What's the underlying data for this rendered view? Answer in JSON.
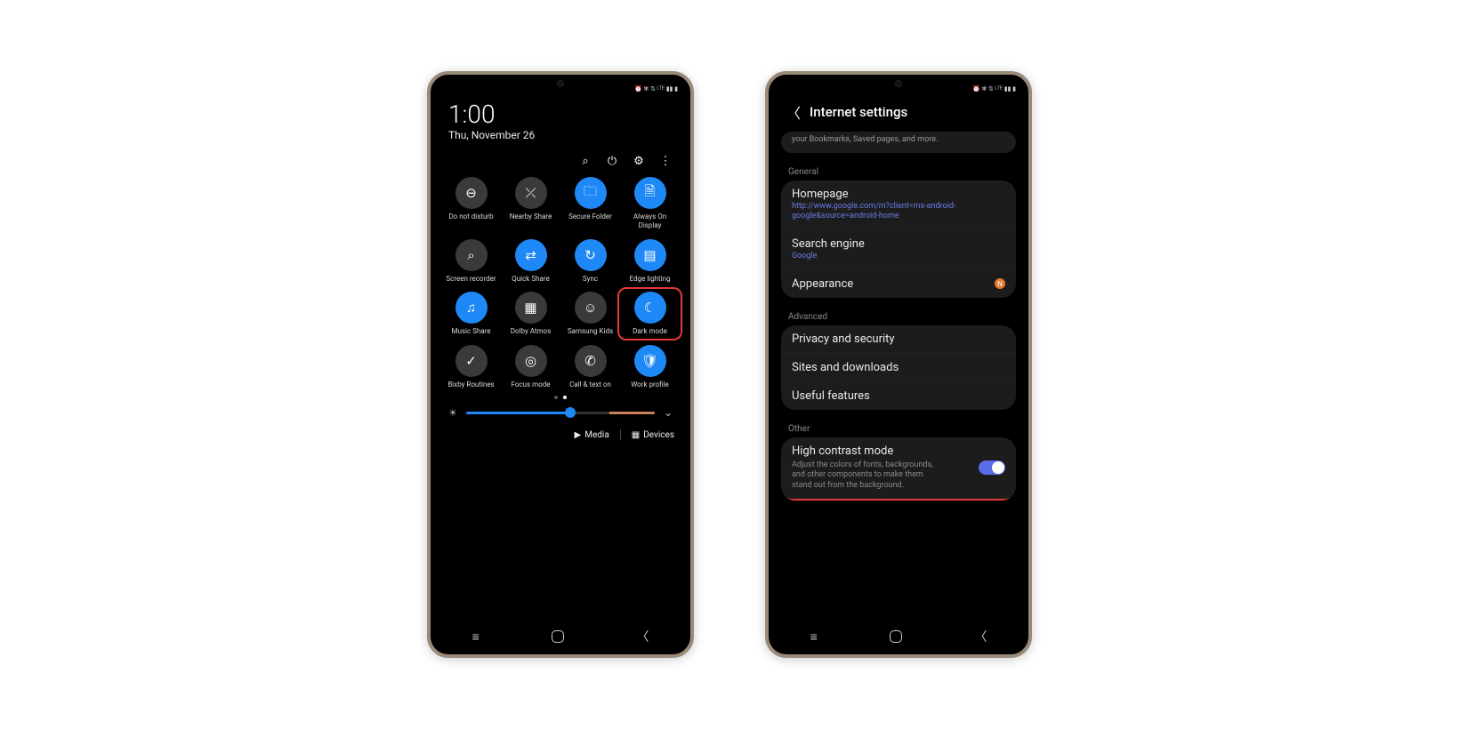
{
  "status_icons": "⏰ ✻ ⇅ ᴸᵀᴱ ▮▮ ▮",
  "quick_panel": {
    "time": "1:00",
    "date": "Thu, November 26",
    "tiles": [
      {
        "icon": "⊖",
        "label": "Do not disturb",
        "on": false,
        "name": "tile-dnd"
      },
      {
        "icon": "⤫",
        "label": "Nearby Share",
        "on": false,
        "name": "tile-nearby-share"
      },
      {
        "icon": "🗀",
        "label": "Secure Folder",
        "on": true,
        "name": "tile-secure-folder"
      },
      {
        "icon": "🗎",
        "label": "Always On Display",
        "on": true,
        "name": "tile-aod"
      },
      {
        "icon": "⌕",
        "label": "Screen recorder",
        "on": false,
        "name": "tile-screen-recorder"
      },
      {
        "icon": "⇄",
        "label": "Quick Share",
        "on": true,
        "name": "tile-quick-share"
      },
      {
        "icon": "↻",
        "label": "Sync",
        "on": true,
        "name": "tile-sync"
      },
      {
        "icon": "▤",
        "label": "Edge lighting",
        "on": true,
        "name": "tile-edge-lighting"
      },
      {
        "icon": "♫",
        "label": "Music Share",
        "on": true,
        "name": "tile-music-share"
      },
      {
        "icon": "▦",
        "label": "Dolby Atmos",
        "on": false,
        "name": "tile-dolby-atmos"
      },
      {
        "icon": "☺",
        "label": "Samsung Kids",
        "on": false,
        "name": "tile-samsung-kids"
      },
      {
        "icon": "☾",
        "label": "Dark mode",
        "on": true,
        "highlight": true,
        "name": "tile-dark-mode"
      },
      {
        "icon": "✓",
        "label": "Bixby Routines",
        "on": false,
        "name": "tile-bixby-routines"
      },
      {
        "icon": "◎",
        "label": "Focus mode",
        "on": false,
        "name": "tile-focus-mode"
      },
      {
        "icon": "✆",
        "label": "Call & text on",
        "on": false,
        "name": "tile-call-text"
      },
      {
        "icon": "🛡",
        "label": "Work profile",
        "on": true,
        "name": "tile-work-profile"
      }
    ],
    "bottom": {
      "media": "Media",
      "devices": "Devices"
    }
  },
  "settings": {
    "title": "Internet settings",
    "sync_tail": "your Bookmarks, Saved pages, and more.",
    "sections": {
      "general": {
        "label": "General",
        "homepage": {
          "title": "Homepage",
          "sub": "http://www.google.com/m?client=ms-android-google&source=android-home"
        },
        "search": {
          "title": "Search engine",
          "sub": "Google"
        },
        "appearance": {
          "title": "Appearance"
        }
      },
      "advanced": {
        "label": "Advanced",
        "privacy": {
          "title": "Privacy and security"
        },
        "sites": {
          "title": "Sites and downloads"
        },
        "useful": {
          "title": "Useful features"
        }
      },
      "other": {
        "label": "Other",
        "high_contrast": {
          "title": "High contrast mode",
          "desc": "Adjust the colors of fonts, backgrounds, and other components to make them stand out from the background."
        }
      }
    }
  }
}
